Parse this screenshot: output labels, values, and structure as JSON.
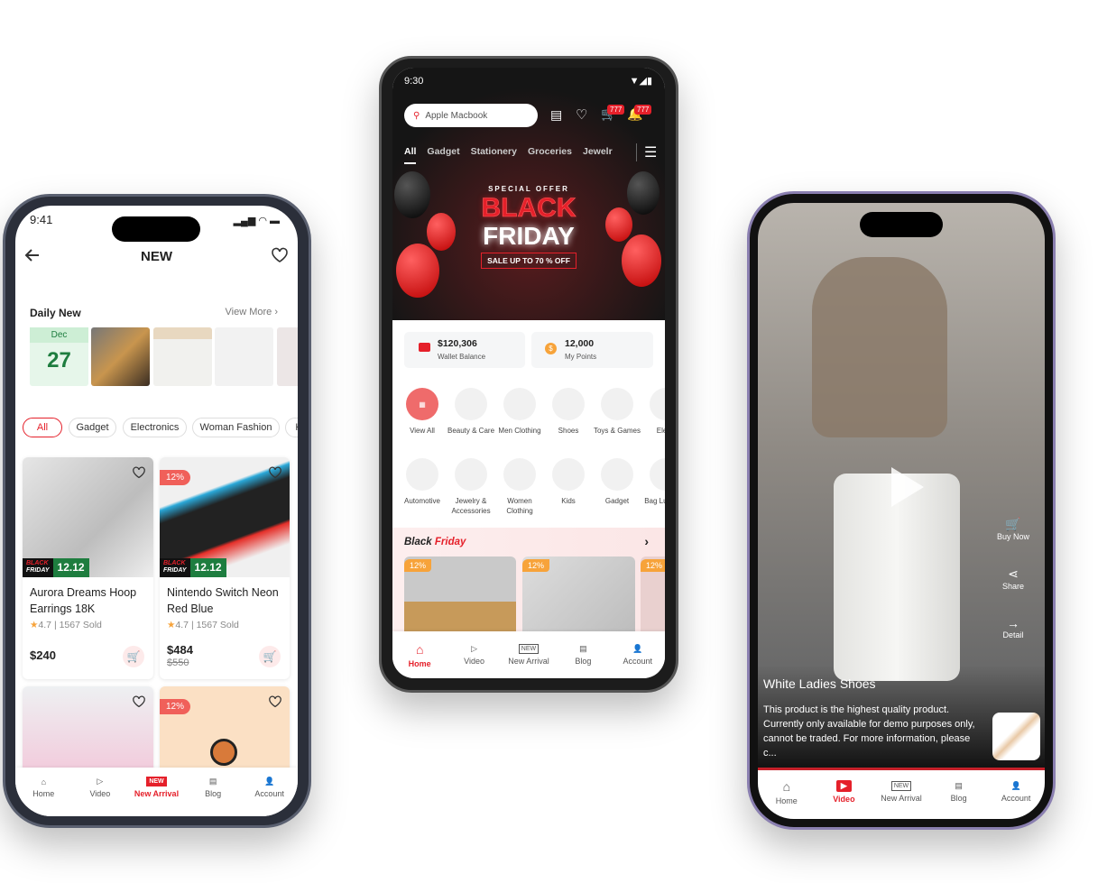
{
  "phone_left": {
    "status_time": "9:41",
    "title": "NEW",
    "daily_new": {
      "title": "Daily New",
      "view_more": "View More",
      "month": "Dec",
      "day": "27"
    },
    "chips": [
      "All",
      "Gadget",
      "Electronics",
      "Woman Fashion",
      "K"
    ],
    "products": [
      {
        "name": "Aurora Dreams Hoop Earrings 18K",
        "rating": "4.7",
        "sold": "1567 Sold",
        "price": "$240",
        "promo": [
          "BLACK",
          "FRIDAY",
          "12.12"
        ]
      },
      {
        "name": "Nintendo Switch Neon Red Blue",
        "rating": "4.7",
        "sold": "1567 Sold",
        "price": "$484",
        "old_price": "$550",
        "discount": "12%",
        "promo": [
          "BLACK",
          "FRIDAY",
          "12.12"
        ]
      },
      {
        "discount": ""
      },
      {
        "discount": "12%"
      }
    ],
    "nav": [
      "Home",
      "Video",
      "New Arrival",
      "Blog",
      "Account"
    ],
    "nav_new_badge": "NEW",
    "active_nav": "New Arrival"
  },
  "phone_center": {
    "status_time": "9:30",
    "search_placeholder": "Apple Macbook",
    "cart_count": "777",
    "notif_count": "777",
    "tabs": [
      "All",
      "Gadget",
      "Stationery",
      "Groceries",
      "Jewelr"
    ],
    "banner": {
      "kicker": "SPECIAL OFFER",
      "line1": "BLACK",
      "line2": "FRIDAY",
      "sale": "SALE UP TO 70 % OFF"
    },
    "wallet": {
      "value": "$120,306",
      "label": "Wallet Balance"
    },
    "points": {
      "value": "12,000",
      "label": "My Points"
    },
    "categories_row1": [
      "View All",
      "Beauty & Care",
      "Men Clothing",
      "Shoes",
      "Toys & Games",
      "Electr"
    ],
    "categories_row2": [
      "Automotive",
      "Jewelry & Accessories",
      "Women Clothing",
      "Kids",
      "Gadget",
      "Bag Luggage"
    ],
    "section": {
      "title_a": "Black",
      "title_b": "Friday"
    },
    "deal_discount": "12%",
    "nav": [
      "Home",
      "Video",
      "New Arrival",
      "Blog",
      "Account"
    ],
    "nav_new_badge": "NEW",
    "active_nav": "Home"
  },
  "phone_right": {
    "actions": [
      "Buy Now",
      "Share",
      "Detail"
    ],
    "video_title": "White Ladies Shoes",
    "video_desc": "This product is the highest quality product. Currently only available for demo purposes only, cannot be traded. For more information, please c...",
    "nav": [
      "Home",
      "Video",
      "New Arrival",
      "Blog",
      "Account"
    ],
    "nav_new_badge": "NEW",
    "active_nav": "Video"
  },
  "colors": {
    "accent": "#e5202a",
    "orange": "#f7a33a",
    "green": "#1e7d3f",
    "calendar_bg": "#dff3e4"
  }
}
